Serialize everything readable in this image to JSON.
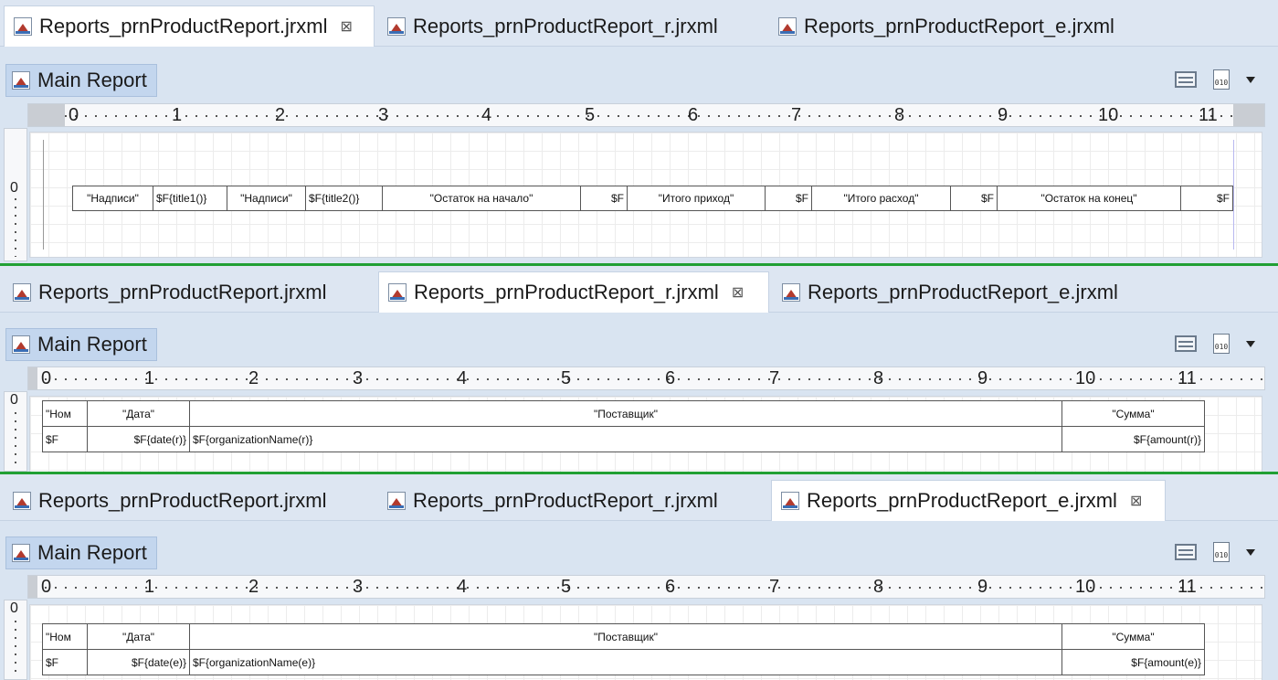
{
  "panels": [
    {
      "tabs": [
        {
          "label": "Reports_prnProductReport.jrxml",
          "active": true
        },
        {
          "label": "Reports_prnProductReport_r.jrxml",
          "active": false
        },
        {
          "label": "Reports_prnProductReport_e.jrxml",
          "active": false
        }
      ],
      "main_report": "Main Report",
      "close_glyph": "⊠",
      "ruler_labels": [
        "0",
        "1",
        "2",
        "3",
        "4",
        "5",
        "6",
        "7",
        "8",
        "9",
        "10",
        "11"
      ],
      "vruler_zero": "0",
      "cells": [
        "\"Надписи\"",
        "$F{title1()}",
        "\"Надписи\"",
        "$F{title2()}",
        "\"Остаток на начало\"",
        "$F",
        "\"Итого приход\"",
        "$F",
        "\"Итого расход\"",
        "$F",
        "\"Остаток на конец\"",
        "$F"
      ]
    },
    {
      "tabs": [
        {
          "label": "Reports_prnProductReport.jrxml",
          "active": false
        },
        {
          "label": "Reports_prnProductReport_r.jrxml",
          "active": true
        },
        {
          "label": "Reports_prnProductReport_e.jrxml",
          "active": false
        }
      ],
      "main_report": "Main Report",
      "close_glyph": "⊠",
      "ruler_labels": [
        "0",
        "1",
        "2",
        "3",
        "4",
        "5",
        "6",
        "7",
        "8",
        "9",
        "10",
        "11"
      ],
      "vruler_zero": "0",
      "header": [
        "\"Ном",
        "\"Дата\"",
        "\"Поставщик\"",
        "\"Сумма\""
      ],
      "row": [
        "$F",
        "$F{date(r)}",
        "$F{organizationName(r)}",
        "$F{amount(r)}"
      ]
    },
    {
      "tabs": [
        {
          "label": "Reports_prnProductReport.jrxml",
          "active": false
        },
        {
          "label": "Reports_prnProductReport_r.jrxml",
          "active": false
        },
        {
          "label": "Reports_prnProductReport_e.jrxml",
          "active": true
        }
      ],
      "main_report": "Main Report",
      "close_glyph": "⊠",
      "ruler_labels": [
        "0",
        "1",
        "2",
        "3",
        "4",
        "5",
        "6",
        "7",
        "8",
        "9",
        "10",
        "11"
      ],
      "vruler_zero": "0",
      "header": [
        "\"Ном",
        "\"Дата\"",
        "\"Поставщик\"",
        "\"Сумма\""
      ],
      "row": [
        "$F",
        "$F{date(e)}",
        "$F{organizationName(e)}",
        "$F{amount(e)}"
      ]
    }
  ],
  "colors": {
    "separator": "#21a034",
    "panel_bg": "#d9e4f1",
    "main_report_bg": "#c3d6ee"
  },
  "doc_icon_text": "010"
}
